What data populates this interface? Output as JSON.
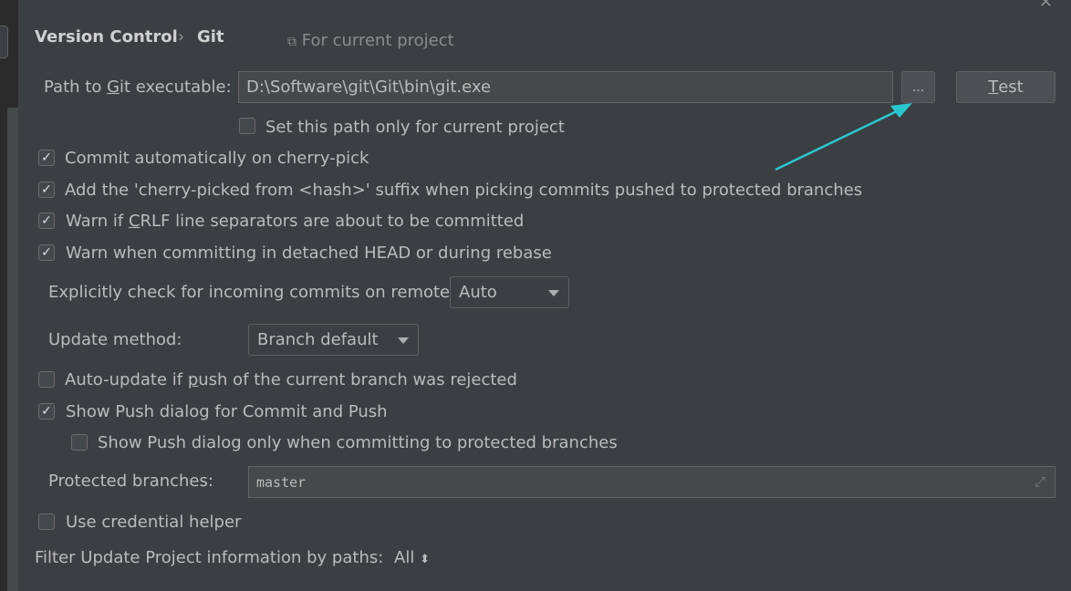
{
  "breadcrumb": {
    "parent": "Version Control",
    "separator": "›",
    "current": "Git",
    "scope_hint": "For current project"
  },
  "git_path": {
    "label_pre": "Path to ",
    "label_mnemonic": "G",
    "label_post": "it executable:",
    "value": "D:\\Software\\git\\Git\\bin\\git.exe",
    "browse_label": "...",
    "test_mnemonic": "T",
    "test_rest": "est"
  },
  "options": {
    "path_current_project": {
      "label": "Set this path only for current project",
      "checked": false
    },
    "commit_cherry_pick": {
      "label": "Commit automatically on cherry-pick",
      "checked": true
    },
    "cherry_suffix": {
      "label": "Add the 'cherry-picked from <hash>' suffix when picking commits pushed to protected branches",
      "checked": true
    },
    "warn_crlf": {
      "label_pre": "Warn if ",
      "label_mnemonic": "C",
      "label_post": "RLF line separators are about to be committed",
      "checked": true
    },
    "warn_detached": {
      "label": "Warn when committing in detached HEAD or during rebase",
      "checked": true
    },
    "auto_update": {
      "label_pre": "Auto-update if ",
      "label_mnemonic": "p",
      "label_post": "ush of the current branch was rejected",
      "checked": false
    },
    "show_push_dialog": {
      "label": "Show Push dialog for Commit and Push",
      "checked": true
    },
    "push_protected_only": {
      "label": "Show Push dialog only when committing to protected branches",
      "checked": false
    },
    "credential_helper": {
      "label": "Use credential helper",
      "checked": false
    }
  },
  "incoming": {
    "label": "Explicitly check for incoming commits on remotes:",
    "value": "Auto"
  },
  "update_method": {
    "label": "Update method:",
    "value": "Branch default"
  },
  "protected": {
    "label": "Protected branches:",
    "value": "master"
  },
  "filter": {
    "label": "Filter Update Project information by paths:",
    "value": "All"
  },
  "annotation": {
    "color": "#29c7cf"
  }
}
